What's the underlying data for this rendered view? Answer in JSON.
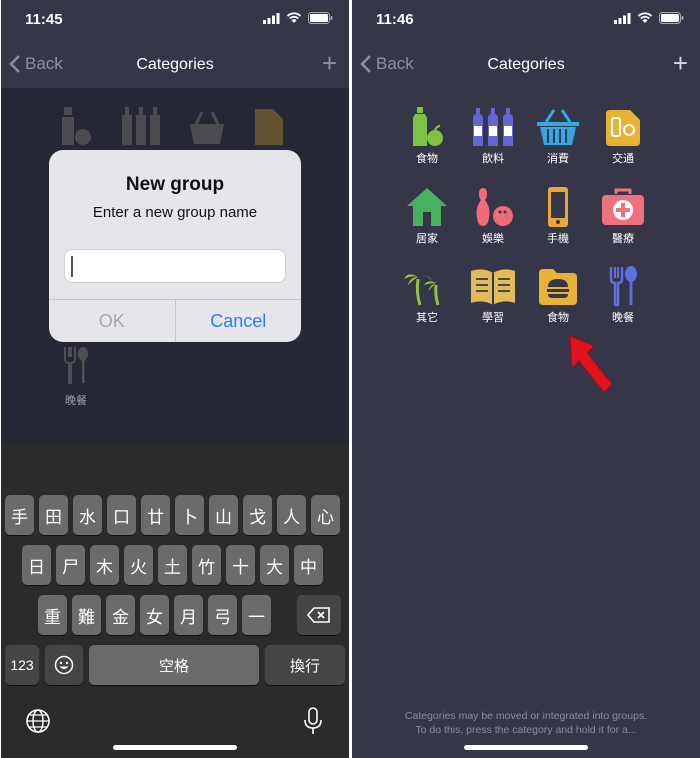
{
  "left": {
    "time": "11:45",
    "nav": {
      "back": "Back",
      "title": "Categories"
    },
    "visible_item": {
      "label": "晚餐",
      "icon": "fork-spoon-icon"
    },
    "alert": {
      "title": "New group",
      "message": "Enter a new group name",
      "input_value": "",
      "ok": "OK",
      "cancel": "Cancel"
    },
    "keyboard": {
      "row1": [
        "手",
        "田",
        "水",
        "口",
        "廿",
        "卜",
        "山",
        "戈",
        "人",
        "心"
      ],
      "row2": [
        "日",
        "尸",
        "木",
        "火",
        "土",
        "竹",
        "十",
        "大",
        "中"
      ],
      "row3": [
        "重",
        "難",
        "金",
        "女",
        "月",
        "弓",
        "一"
      ],
      "numbers": "123",
      "space": "空格",
      "return": "換行"
    }
  },
  "right": {
    "time": "11:46",
    "nav": {
      "back": "Back",
      "title": "Categories"
    },
    "items": [
      {
        "label": "食物",
        "icon": "bottle-apple-icon",
        "color": "#7dc243"
      },
      {
        "label": "飲料",
        "icon": "bottles-icon",
        "color": "#6466d6"
      },
      {
        "label": "消費",
        "icon": "basket-icon",
        "color": "#34a8e0"
      },
      {
        "label": "交通",
        "icon": "fuel-icon",
        "color": "#e8b234"
      },
      {
        "label": "居家",
        "icon": "house-icon",
        "color": "#48b061"
      },
      {
        "label": "娛樂",
        "icon": "bowling-icon",
        "color": "#f06b7a"
      },
      {
        "label": "手機",
        "icon": "phone-icon",
        "color": "#e7a63a"
      },
      {
        "label": "醫療",
        "icon": "medkit-icon",
        "color": "#f0707c"
      },
      {
        "label": "其它",
        "icon": "palm-icon",
        "color": "#96c041"
      },
      {
        "label": "學習",
        "icon": "book-icon",
        "color": "#e3ba58"
      },
      {
        "label": "食物",
        "icon": "burger-folder-icon",
        "color": "#e7b23a"
      },
      {
        "label": "晚餐",
        "icon": "fork-spoon-icon",
        "color": "#5d70e0"
      }
    ],
    "footer_line1": "Categories may be moved or integrated into groups.",
    "footer_line2": "To do this, press the category and hold it for a..."
  }
}
